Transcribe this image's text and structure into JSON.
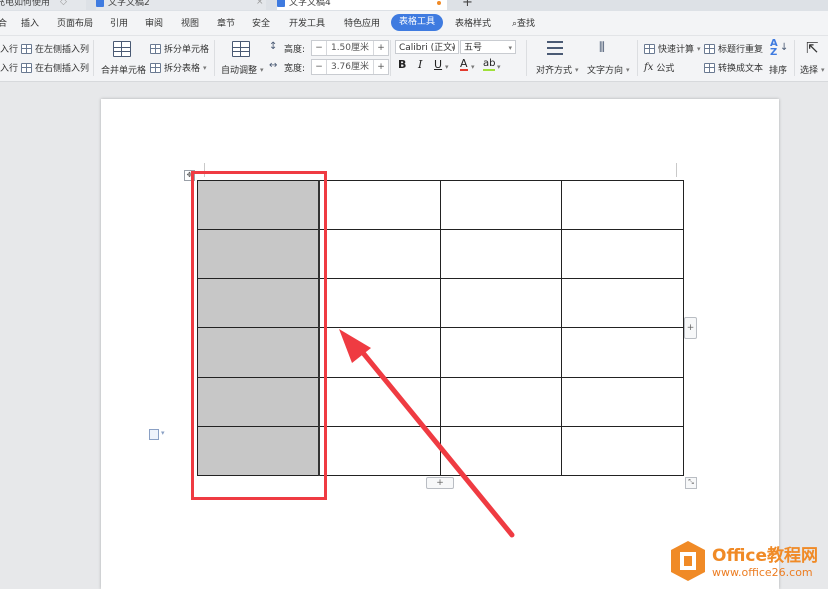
{
  "tabs": [
    {
      "label": "充电如何使用"
    },
    {
      "label": "文字文稿2"
    },
    {
      "label": "文字文稿4"
    }
  ],
  "menu": {
    "items": [
      "插入",
      "页面布局",
      "引用",
      "审阅",
      "视图",
      "章节",
      "安全",
      "开发工具",
      "特色应用"
    ],
    "active": "表格工具",
    "after": "表格样式",
    "search": "查找"
  },
  "ribbon": {
    "insert_row": "入行",
    "insert_row2": "入行",
    "insert_left_col": "在左侧插入列",
    "insert_right_col": "在右侧插入列",
    "merge_cells": "合并单元格",
    "split_cells": "拆分单元格",
    "split_table": "拆分表格",
    "auto_adjust": "自动调整",
    "height_label": "高度:",
    "height_value": "1.50厘米",
    "width_label": "宽度:",
    "width_value": "3.76厘米",
    "font_name": "Calibri (正文)",
    "font_size": "五号",
    "bold": "B",
    "italic": "I",
    "underline": "U",
    "font_color": "A",
    "highlight": "ab",
    "align": "对齐方式",
    "text_direction": "文字方向",
    "quick_calc": "快速计算",
    "formula": "公式",
    "repeat_header": "标题行重复",
    "to_text": "转换成文本",
    "sort": "排序",
    "select": "选择"
  },
  "watermark": {
    "title": "Office教程网",
    "url": "www.office26.com"
  },
  "colors": {
    "accent": "#3f7be0",
    "highlight_box": "#ef3b42",
    "shaded_cell": "#c7c7c7",
    "watermark": "#f08a26"
  }
}
